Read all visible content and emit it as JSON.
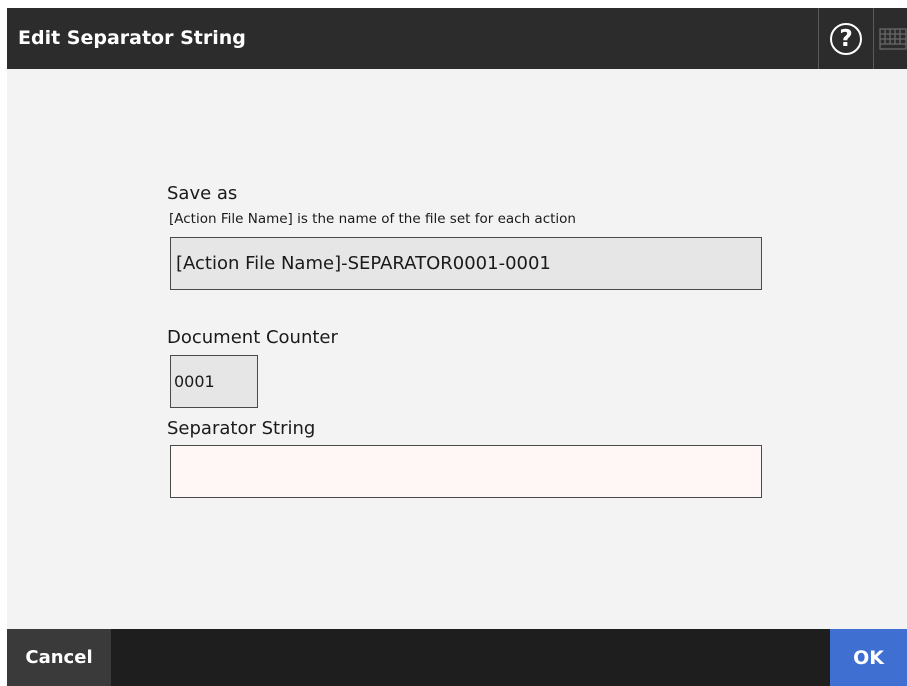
{
  "header": {
    "title": "Edit Separator String",
    "help_icon": "question-circle-icon",
    "keyboard_icon": "keyboard-icon"
  },
  "form": {
    "save_as_label": "Save as",
    "save_as_hint": "[Action File Name] is the name of the file set for each action",
    "save_as_value": "[Action File Name]-SEPARATOR0001-0001",
    "document_counter_label": "Document Counter",
    "document_counter_value": "0001",
    "separator_string_label": "Separator String",
    "separator_string_value": ""
  },
  "footer": {
    "cancel_label": "Cancel",
    "ok_label": "OK"
  },
  "colors": {
    "header_bg": "#2c2c2c",
    "content_bg": "#f3f3f3",
    "footer_bg": "#1e1e1e",
    "cancel_bg": "#3a3a3a",
    "ok_bg": "#3e6fd1",
    "input_active_bg": "#fff6f6"
  }
}
